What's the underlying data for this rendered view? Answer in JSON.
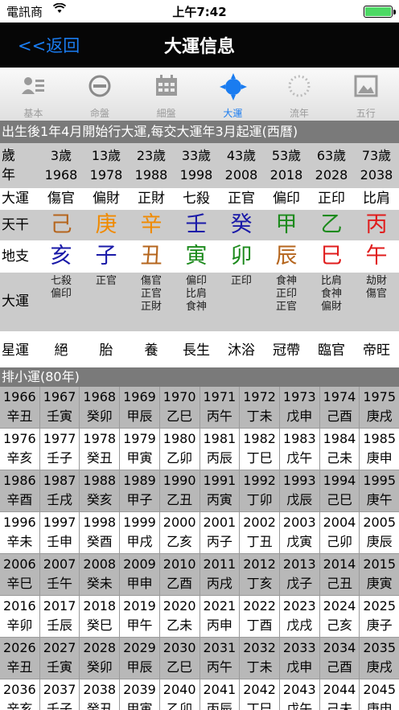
{
  "status": {
    "carrier": "電訊商",
    "time": "上午7:42"
  },
  "navbar": {
    "back": "<<返回",
    "title": "大運信息"
  },
  "tabs": [
    {
      "label": "基本",
      "icon": "person-card-icon",
      "active": false
    },
    {
      "label": "命盤",
      "icon": "circle-chart-icon",
      "active": false
    },
    {
      "label": "細盤",
      "icon": "calendar-grid-icon",
      "active": false
    },
    {
      "label": "大運",
      "icon": "sun-icon",
      "active": true
    },
    {
      "label": "流年",
      "icon": "dotted-circle-icon",
      "active": false
    },
    {
      "label": "五行",
      "icon": "picture-icon",
      "active": false
    }
  ],
  "banner": "出生後1年4月開始行大運,每交大運年3月起運(西曆)",
  "grid": {
    "age": {
      "head": "歲\n年",
      "values": [
        {
          "age": "3歲",
          "year": "1968"
        },
        {
          "age": "13歲",
          "year": "1978"
        },
        {
          "age": "23歲",
          "year": "1988"
        },
        {
          "age": "33歲",
          "year": "1998"
        },
        {
          "age": "43歲",
          "year": "2008"
        },
        {
          "age": "53歲",
          "year": "2018"
        },
        {
          "age": "63歲",
          "year": "2028"
        },
        {
          "age": "73歲",
          "year": "2038"
        }
      ]
    },
    "dayun": {
      "head": "大運",
      "values": [
        "傷官",
        "偏財",
        "正財",
        "七殺",
        "正官",
        "偏印",
        "正印",
        "比肩"
      ]
    },
    "tiangan": {
      "head": "天干",
      "values": [
        {
          "char": "己",
          "color": "#b5651d"
        },
        {
          "char": "庚",
          "color": "#f08a00"
        },
        {
          "char": "辛",
          "color": "#f08a00"
        },
        {
          "char": "壬",
          "color": "#1a1aa8"
        },
        {
          "char": "癸",
          "color": "#1a1aa8"
        },
        {
          "char": "甲",
          "color": "#1c8a1c"
        },
        {
          "char": "乙",
          "color": "#1c8a1c"
        },
        {
          "char": "丙",
          "color": "#e01c1c"
        }
      ]
    },
    "dizhi": {
      "head": "地支",
      "values": [
        {
          "char": "亥",
          "color": "#1a1aa8"
        },
        {
          "char": "子",
          "color": "#1a1aa8"
        },
        {
          "char": "丑",
          "color": "#b5651d"
        },
        {
          "char": "寅",
          "color": "#1c8a1c"
        },
        {
          "char": "卯",
          "color": "#1c8a1c"
        },
        {
          "char": "辰",
          "color": "#b5651d"
        },
        {
          "char": "巳",
          "color": "#e01c1c"
        },
        {
          "char": "午",
          "color": "#e01c1c"
        }
      ]
    },
    "canggan": {
      "head": "大運",
      "values": [
        [
          "七殺",
          "偏印"
        ],
        [
          "正官"
        ],
        [
          "傷官",
          "正官",
          "正財"
        ],
        [
          "偏印",
          "比肩",
          "食神"
        ],
        [
          "正印"
        ],
        [
          "食神",
          "正印",
          "正官"
        ],
        [
          "比肩",
          "食神",
          "偏財"
        ],
        [
          "劫財",
          "傷官"
        ]
      ]
    },
    "xingyun": {
      "head": "星運",
      "values": [
        "絕",
        "胎",
        "養",
        "長生",
        "沐浴",
        "冠帶",
        "臨官",
        "帝旺"
      ]
    }
  },
  "banner2": "排小運(80年)",
  "xiaoyun": [
    [
      [
        "1966",
        "辛丑"
      ],
      [
        "1967",
        "壬寅"
      ],
      [
        "1968",
        "癸卯"
      ],
      [
        "1969",
        "甲辰"
      ],
      [
        "1970",
        "乙巳"
      ],
      [
        "1971",
        "丙午"
      ],
      [
        "1972",
        "丁未"
      ],
      [
        "1973",
        "戊申"
      ],
      [
        "1974",
        "己酉"
      ],
      [
        "1975",
        "庚戌"
      ]
    ],
    [
      [
        "1976",
        "辛亥"
      ],
      [
        "1977",
        "壬子"
      ],
      [
        "1978",
        "癸丑"
      ],
      [
        "1979",
        "甲寅"
      ],
      [
        "1980",
        "乙卯"
      ],
      [
        "1981",
        "丙辰"
      ],
      [
        "1982",
        "丁巳"
      ],
      [
        "1983",
        "戊午"
      ],
      [
        "1984",
        "己未"
      ],
      [
        "1985",
        "庚申"
      ]
    ],
    [
      [
        "1986",
        "辛酉"
      ],
      [
        "1987",
        "壬戌"
      ],
      [
        "1988",
        "癸亥"
      ],
      [
        "1989",
        "甲子"
      ],
      [
        "1990",
        "乙丑"
      ],
      [
        "1991",
        "丙寅"
      ],
      [
        "1992",
        "丁卯"
      ],
      [
        "1993",
        "戊辰"
      ],
      [
        "1994",
        "己巳"
      ],
      [
        "1995",
        "庚午"
      ]
    ],
    [
      [
        "1996",
        "辛未"
      ],
      [
        "1997",
        "壬申"
      ],
      [
        "1998",
        "癸酉"
      ],
      [
        "1999",
        "甲戌"
      ],
      [
        "2000",
        "乙亥"
      ],
      [
        "2001",
        "丙子"
      ],
      [
        "2002",
        "丁丑"
      ],
      [
        "2003",
        "戊寅"
      ],
      [
        "2004",
        "己卯"
      ],
      [
        "2005",
        "庚辰"
      ]
    ],
    [
      [
        "2006",
        "辛巳"
      ],
      [
        "2007",
        "壬午"
      ],
      [
        "2008",
        "癸未"
      ],
      [
        "2009",
        "甲申"
      ],
      [
        "2010",
        "乙酉"
      ],
      [
        "2011",
        "丙戌"
      ],
      [
        "2012",
        "丁亥"
      ],
      [
        "2013",
        "戊子"
      ],
      [
        "2014",
        "己丑"
      ],
      [
        "2015",
        "庚寅"
      ]
    ],
    [
      [
        "2016",
        "辛卯"
      ],
      [
        "2017",
        "壬辰"
      ],
      [
        "2018",
        "癸巳"
      ],
      [
        "2019",
        "甲午"
      ],
      [
        "2020",
        "乙未"
      ],
      [
        "2021",
        "丙申"
      ],
      [
        "2022",
        "丁酉"
      ],
      [
        "2023",
        "戊戌"
      ],
      [
        "2024",
        "己亥"
      ],
      [
        "2025",
        "庚子"
      ]
    ],
    [
      [
        "2026",
        "辛丑"
      ],
      [
        "2027",
        "壬寅"
      ],
      [
        "2028",
        "癸卯"
      ],
      [
        "2029",
        "甲辰"
      ],
      [
        "2030",
        "乙巳"
      ],
      [
        "2031",
        "丙午"
      ],
      [
        "2032",
        "丁未"
      ],
      [
        "2033",
        "戊申"
      ],
      [
        "2034",
        "己酉"
      ],
      [
        "2035",
        "庚戌"
      ]
    ],
    [
      [
        "2036",
        "辛亥"
      ],
      [
        "2037",
        "壬子"
      ],
      [
        "2038",
        "癸丑"
      ],
      [
        "2039",
        "甲寅"
      ],
      [
        "2040",
        "乙卯"
      ],
      [
        "2041",
        "丙辰"
      ],
      [
        "2042",
        "丁巳"
      ],
      [
        "2043",
        "戊午"
      ],
      [
        "2044",
        "己未"
      ],
      [
        "2045",
        "庚申"
      ]
    ]
  ]
}
